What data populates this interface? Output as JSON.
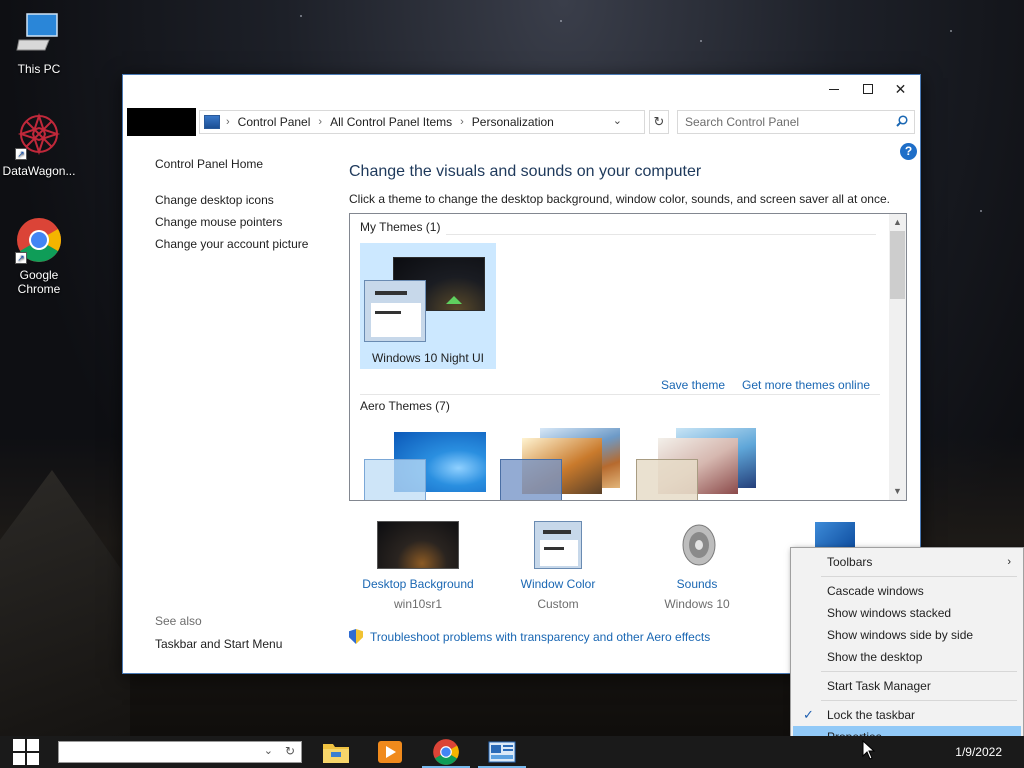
{
  "desktop": {
    "icons": [
      {
        "label": "This PC"
      },
      {
        "label": "DataWagon..."
      },
      {
        "label": "Google Chrome"
      }
    ]
  },
  "window": {
    "address": {
      "crumbs": [
        "Control Panel",
        "All Control Panel Items",
        "Personalization"
      ],
      "search_placeholder": "Search Control Panel"
    },
    "sidebar": {
      "home": "Control Panel Home",
      "links": [
        "Change desktop icons",
        "Change mouse pointers",
        "Change your account picture"
      ],
      "see_also": "See also",
      "see_also_links": [
        "Taskbar and Start Menu"
      ]
    },
    "main": {
      "title": "Change the visuals and sounds on your computer",
      "subtitle": "Click a theme to change the desktop background, window color, sounds, and screen saver all at once.",
      "my_themes_header": "My Themes (1)",
      "selected_theme": "Windows 10 Night UI",
      "save_theme": "Save theme",
      "more_themes": "Get more themes online",
      "aero_header": "Aero Themes (7)",
      "bottom": [
        {
          "label": "Desktop Background",
          "sub": "win10sr1"
        },
        {
          "label": "Window Color",
          "sub": "Custom"
        },
        {
          "label": "Sounds",
          "sub": "Windows 10"
        }
      ],
      "troubleshoot": "Troubleshoot problems with transparency and other Aero effects"
    }
  },
  "context_menu": {
    "items": [
      {
        "label": "Toolbars",
        "submenu": true
      },
      {
        "label": "Cascade windows"
      },
      {
        "label": "Show windows stacked"
      },
      {
        "label": "Show windows side by side"
      },
      {
        "label": "Show the desktop"
      },
      {
        "label": "Start Task Manager"
      },
      {
        "label": "Lock the taskbar",
        "checked": true
      },
      {
        "label": "Properties",
        "highlighted": true
      }
    ]
  },
  "taskbar": {
    "apps": [
      "file-explorer-icon",
      "media-player-icon",
      "chrome-icon",
      "control-panel-icon"
    ],
    "date": "1/9/2022"
  },
  "colors": {
    "link": "#1a67b3",
    "title": "#1e395b",
    "selection": "#cce8ff",
    "menu_highlight": "#91c9f7"
  }
}
